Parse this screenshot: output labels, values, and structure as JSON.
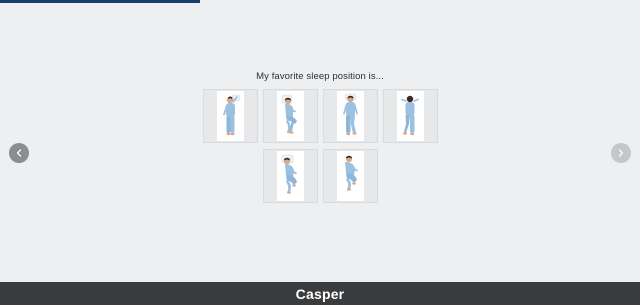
{
  "progress": {
    "fraction": 0.3125,
    "color": "#1c3d6e"
  },
  "question": {
    "text": "My favorite sleep position is..."
  },
  "options": [
    {
      "pose": "back-arm-up"
    },
    {
      "pose": "side-fetal-pillow"
    },
    {
      "pose": "back-arms-down"
    },
    {
      "pose": "stomach-arms-up"
    },
    {
      "pose": "side-curled-pillow"
    },
    {
      "pose": "side-curled"
    }
  ],
  "navigation": {
    "prev_icon": "chevron-left-icon",
    "next_icon": "chevron-right-icon"
  },
  "footer": {
    "logo_text": "Casper",
    "background": "#3a3b3d"
  },
  "colors": {
    "background": "#eeeff1",
    "pajama": "#9cc0e0",
    "skin": "#d8a98a",
    "hair": "#3a2a22"
  }
}
